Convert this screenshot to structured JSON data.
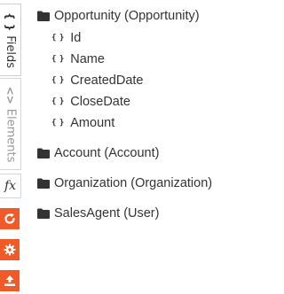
{
  "sidebar": {
    "tabs": [
      {
        "label": "Fields",
        "icon": "braces-icon",
        "glyph": "{ }",
        "active": true
      },
      {
        "label": "Elements",
        "icon": "code-icon",
        "glyph": "<>",
        "active": false
      },
      {
        "label": "",
        "icon": "function-icon",
        "glyph": "fx",
        "active": false
      }
    ],
    "actions": [
      {
        "icon": "refresh-icon",
        "color": "#f05a28"
      },
      {
        "icon": "gear-icon",
        "color": "#f05a28"
      },
      {
        "icon": "upload-icon",
        "color": "#f05a28"
      }
    ]
  },
  "tree": {
    "objects": [
      {
        "label": "Opportunity (Opportunity)",
        "expanded": true,
        "fields": [
          "Id",
          "Name",
          "CreatedDate",
          "CloseDate",
          "Amount"
        ]
      },
      {
        "label": "Account (Account)",
        "expanded": false,
        "fields": []
      },
      {
        "label": "Organization (Organization)",
        "expanded": false,
        "fields": []
      },
      {
        "label": "SalesAgent (User)",
        "expanded": false,
        "fields": []
      }
    ],
    "field_glyph": "{ }"
  },
  "colors": {
    "accent": "#f05a28",
    "text": "#333333",
    "muted": "#9a9a9a",
    "border": "#d6d6d6"
  }
}
